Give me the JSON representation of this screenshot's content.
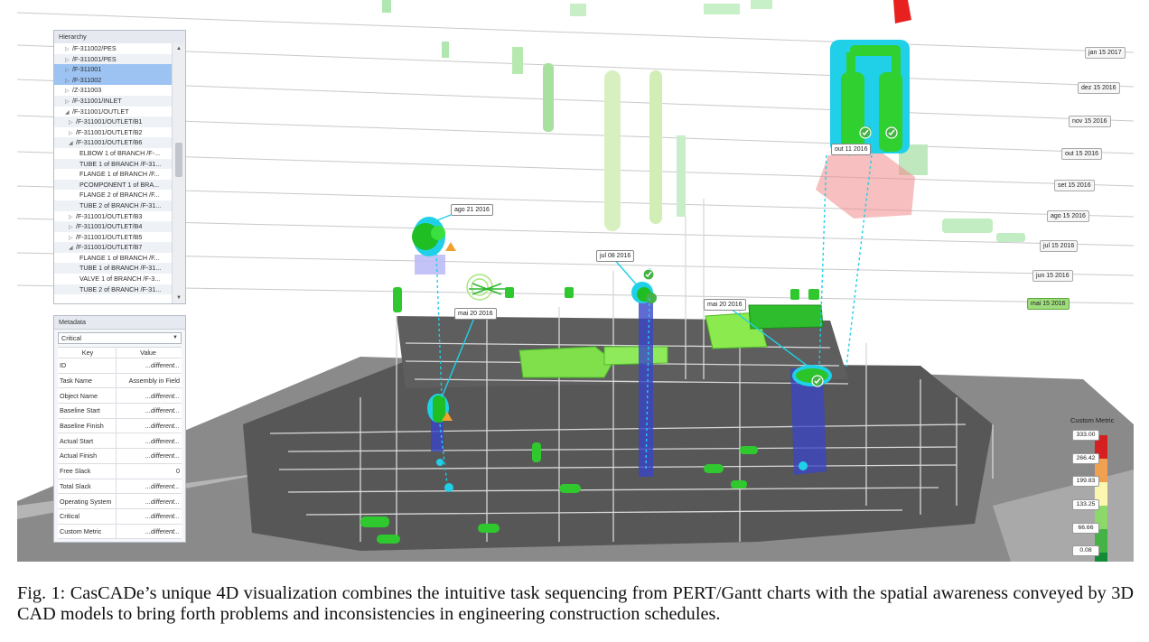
{
  "hierarchy": {
    "title": "Hierarchy",
    "rows": [
      {
        "caret": "▷",
        "label": "/F-311002/PES"
      },
      {
        "caret": "▷",
        "label": "/F-311001/PES"
      },
      {
        "caret": "▷",
        "label": "/F-311001",
        "selected": true
      },
      {
        "caret": "▷",
        "label": "/F-311002",
        "selected": true
      },
      {
        "caret": "▷",
        "label": "/Z-311003"
      },
      {
        "caret": "▷",
        "label": "/F-311001/INLET"
      },
      {
        "caret": "◢",
        "label": "/F-311001/OUTLET"
      },
      {
        "caret": "▷",
        "label": "/F-311001/OUTLET/B1"
      },
      {
        "caret": "▷",
        "label": "/F-311001/OUTLET/B2"
      },
      {
        "caret": "◢",
        "label": "/F-311001/OUTLET/B6"
      },
      {
        "caret": "",
        "label": "ELBOW 1 of BRANCH /F-..."
      },
      {
        "caret": "",
        "label": "TUBE 1 of BRANCH /F-31..."
      },
      {
        "caret": "",
        "label": "FLANGE 1 of BRANCH /F..."
      },
      {
        "caret": "",
        "label": "PCOMPONENT 1 of BRA..."
      },
      {
        "caret": "",
        "label": "FLANGE 2 of BRANCH /F..."
      },
      {
        "caret": "",
        "label": "TUBE 2 of BRANCH /F-31..."
      },
      {
        "caret": "▷",
        "label": "/F-311001/OUTLET/B3"
      },
      {
        "caret": "▷",
        "label": "/F-311001/OUTLET/B4"
      },
      {
        "caret": "▷",
        "label": "/F-311001/OUTLET/B5"
      },
      {
        "caret": "◢",
        "label": "/F-311001/OUTLET/B7"
      },
      {
        "caret": "",
        "label": "FLANGE 1 of BRANCH /F..."
      },
      {
        "caret": "",
        "label": "TUBE 1 of BRANCH /F-31..."
      },
      {
        "caret": "",
        "label": "VALVE 1 of BRANCH /F-3..."
      },
      {
        "caret": "",
        "label": "TUBE 2 of BRANCH /F-31..."
      }
    ]
  },
  "metadata": {
    "title": "Metadata",
    "filter": "Critical",
    "key_header": "Key",
    "value_header": "Value",
    "rows": [
      {
        "key": "ID",
        "value": "...different..."
      },
      {
        "key": "Task Name",
        "value": "Assembly in Field"
      },
      {
        "key": "Object Name",
        "value": "...different..."
      },
      {
        "key": "Baseline Start",
        "value": "...different..."
      },
      {
        "key": "Baseline Finish",
        "value": "...different..."
      },
      {
        "key": "Actual Start",
        "value": "...different..."
      },
      {
        "key": "Actual Finish",
        "value": "...different..."
      },
      {
        "key": "Free Slack",
        "value": "0"
      },
      {
        "key": "Total Slack",
        "value": "...different..."
      },
      {
        "key": "Operating System",
        "value": "...different..."
      },
      {
        "key": "Critical",
        "value": "...different..."
      },
      {
        "key": "Custom Metric",
        "value": "...different..."
      }
    ]
  },
  "timeline": [
    {
      "label": "jan 15 2017"
    },
    {
      "label": "dez 15 2016"
    },
    {
      "label": "nov 15 2016"
    },
    {
      "label": "out 15 2016"
    },
    {
      "label": "set 15 2016"
    },
    {
      "label": "ago 15 2016"
    },
    {
      "label": "jul 15 2016"
    },
    {
      "label": "jun 15 2016"
    },
    {
      "label": "mai 15 2016",
      "active": true
    }
  ],
  "annotations": [
    {
      "label": "ago 21 2016"
    },
    {
      "label": "jul 08 2016"
    },
    {
      "label": "out 11 2016"
    },
    {
      "label": "mai 20 2016"
    },
    {
      "label": "mai 20 2016"
    }
  ],
  "legend": {
    "title": "Custom Metric",
    "labels": [
      "333.00",
      "266.42",
      "199.83",
      "133.25",
      "66.66",
      "0.08"
    ],
    "colors": [
      "#d42020",
      "#f0a050",
      "#fbf7b0",
      "#8cd868",
      "#44b244",
      "#128a36"
    ]
  },
  "colors": {
    "accent_cyan": "#1fd0e8",
    "task_green": "#3fcf3f",
    "schedule_blue": "#3a44c8",
    "delay_red": "#f08a8a"
  },
  "caption": "Fig. 1: CasCADe’s unique 4D visualization combines the intuitive task sequencing from PERT/Gantt charts with the spatial awareness conveyed by 3D CAD models to bring forth problems and inconsistencies in engineering construction schedules."
}
